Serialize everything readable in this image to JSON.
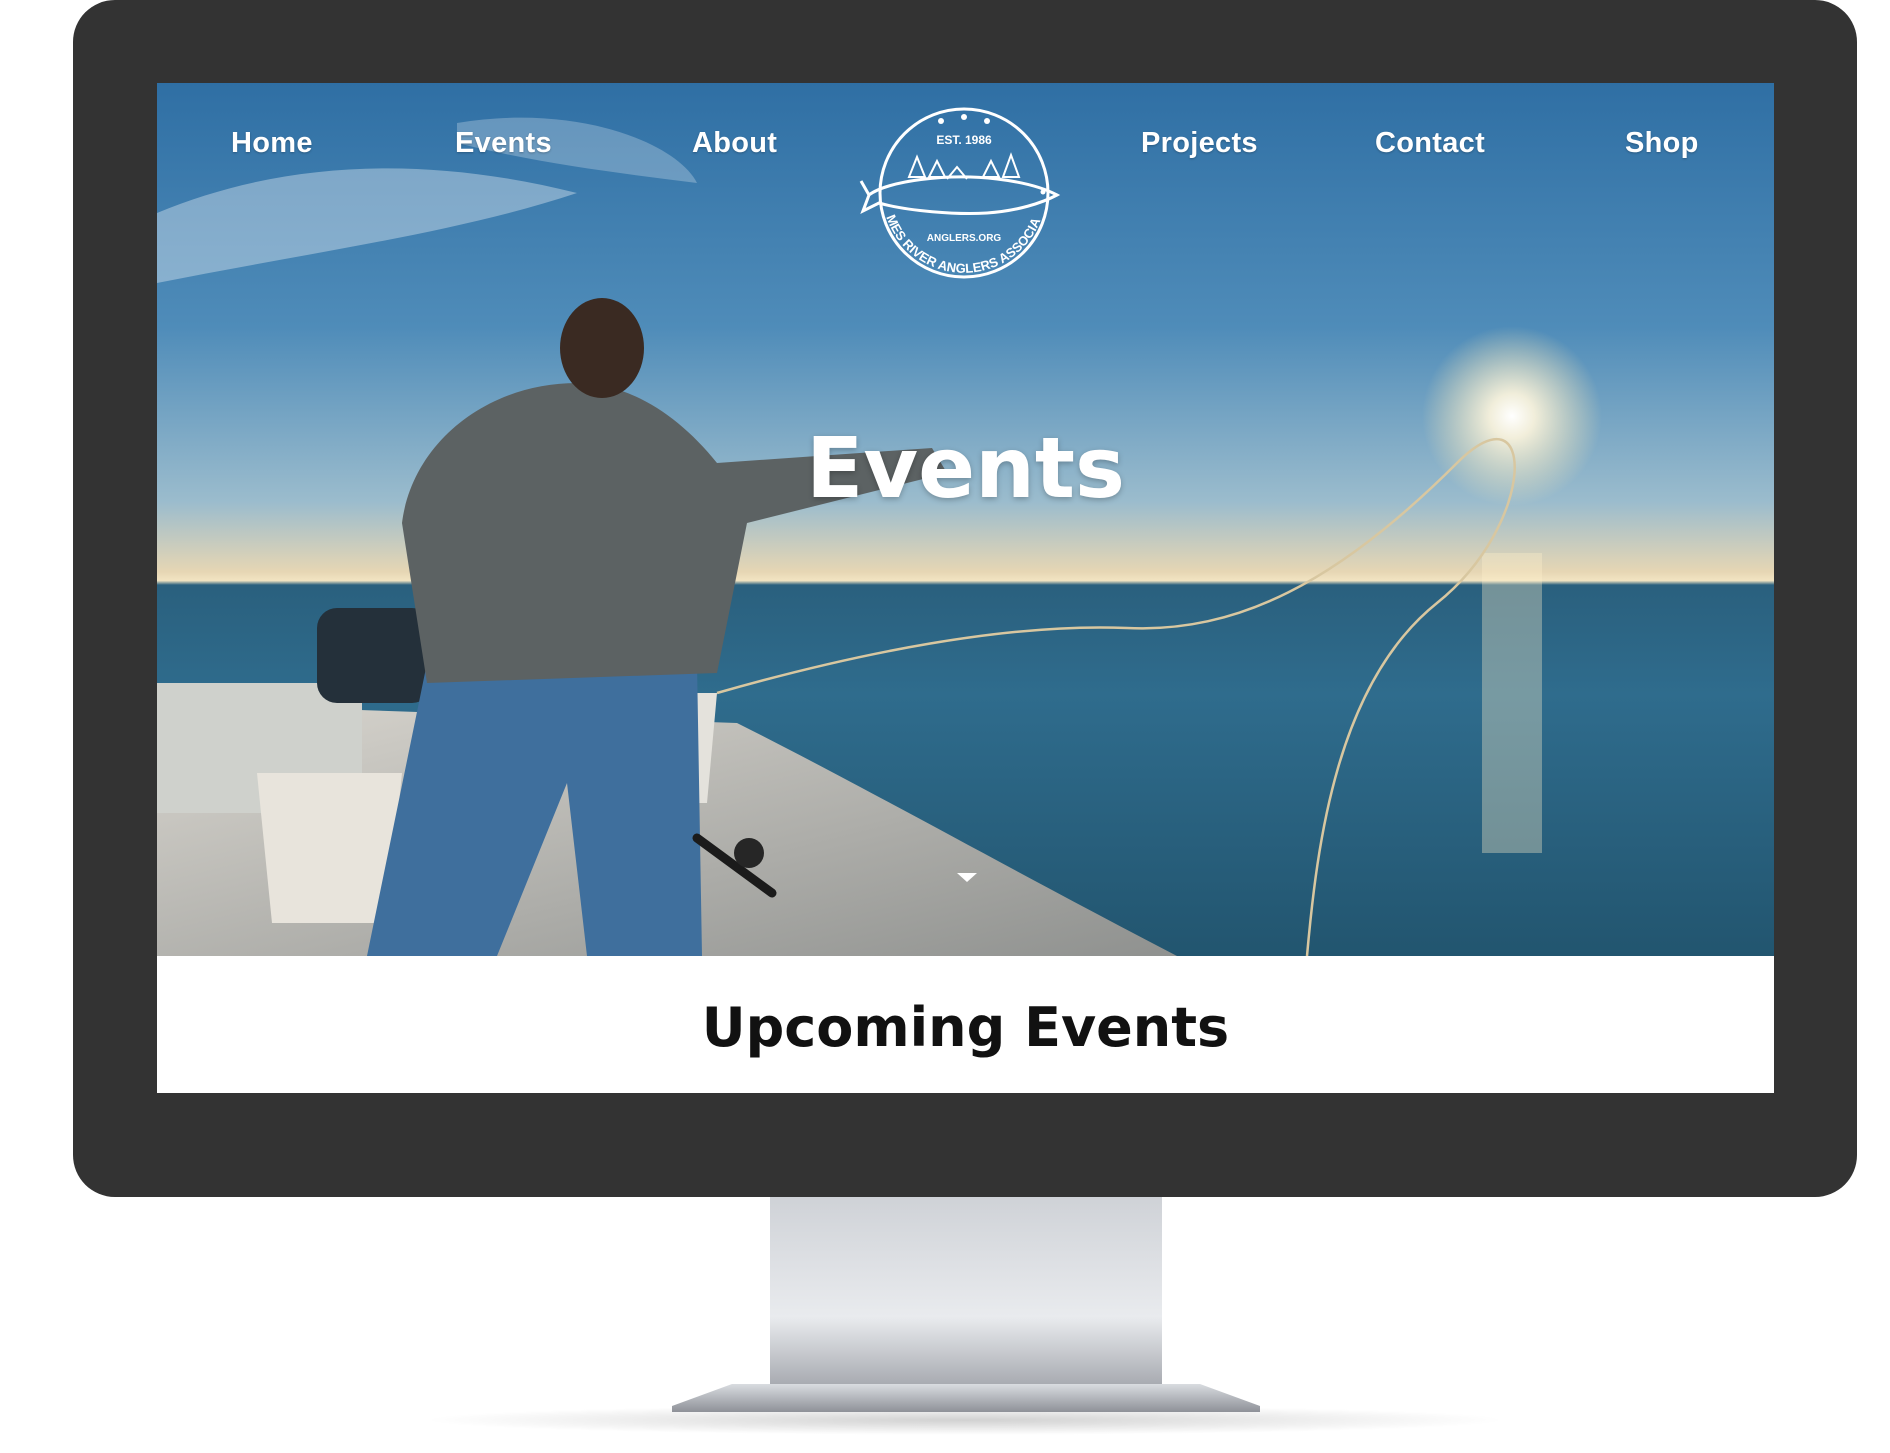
{
  "nav": {
    "items": [
      {
        "label": "Home"
      },
      {
        "label": "Events"
      },
      {
        "label": "About"
      },
      {
        "label": "Projects"
      },
      {
        "label": "Contact"
      },
      {
        "label": "Shop"
      }
    ]
  },
  "logo": {
    "established": "EST. 1986",
    "site": "ANGLERS.ORG",
    "org_name": "THAMES RIVER ANGLERS ASSOCIATION"
  },
  "hero": {
    "title": "Events"
  },
  "main": {
    "section_title": "Upcoming Events"
  },
  "colors": {
    "bezel": "#333333",
    "text_light": "#ffffff",
    "text_dark": "#111111"
  }
}
